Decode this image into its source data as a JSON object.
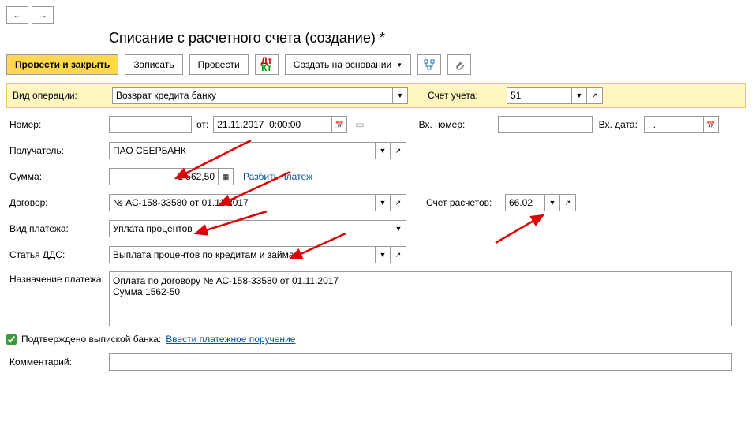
{
  "title": "Списание с расчетного счета (создание) *",
  "nav": {
    "back": "←",
    "forward": "→"
  },
  "toolbar": {
    "post_close": "Провести и закрыть",
    "save": "Записать",
    "post": "Провести",
    "create_based": "Создать на основании"
  },
  "labels": {
    "operation_type": "Вид операции:",
    "account": "Счет учета:",
    "number": "Номер:",
    "from": "от:",
    "in_number": "Вх. номер:",
    "in_date": "Вх. дата:",
    "recipient": "Получатель:",
    "amount": "Сумма:",
    "split": "Разбить платеж",
    "contract": "Договор:",
    "calc_account": "Счет расчетов:",
    "payment_type": "Вид платежа:",
    "dds": "Статья ДДС:",
    "purpose": "Назначение платежа:",
    "confirmed": "Подтверждено выпиской банка:",
    "enter_order": "Ввести платежное поручение",
    "comment": "Комментарий:"
  },
  "values": {
    "operation_type": "Возврат кредита банку",
    "account": "51",
    "date": "21.11.2017  0:00:00",
    "in_date": ". .",
    "recipient": "ПАО СБЕРБАНК",
    "amount": "1 562,50",
    "contract": "№ АС-158-33580 от 01.11.2017",
    "calc_account": "66.02",
    "payment_type": "Уплата процентов",
    "dds": "Выплата процентов по кредитам и займам",
    "purpose": "Оплата по договору № АС-158-33580 от 01.11.2017\nСумма 1562-50"
  }
}
